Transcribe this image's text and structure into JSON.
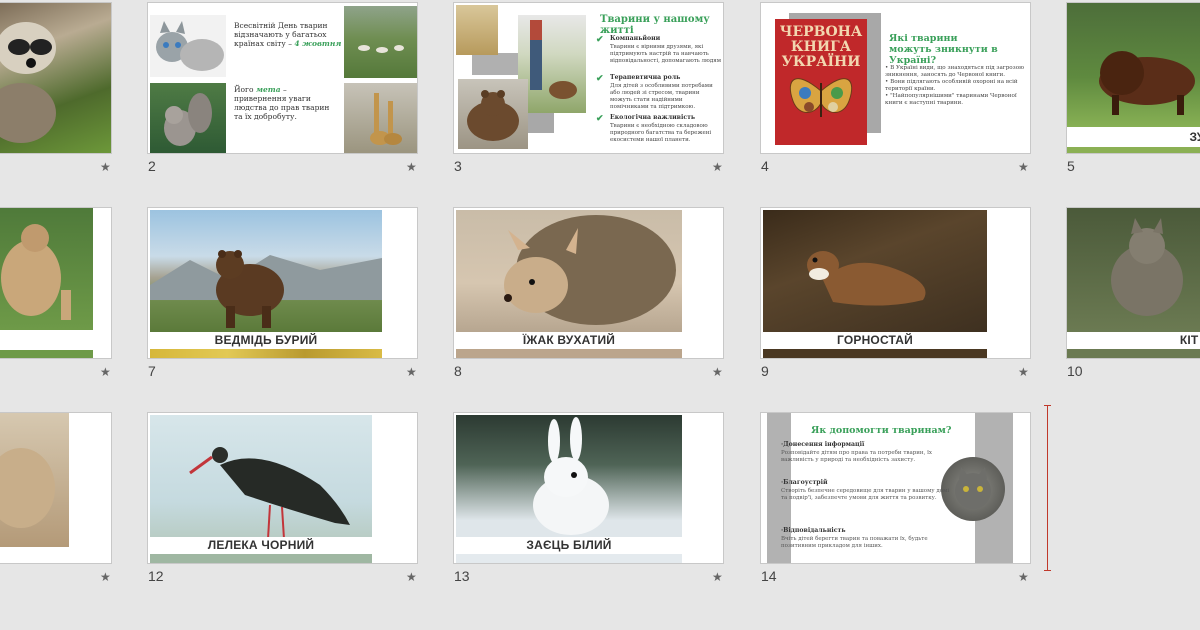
{
  "slides": [
    {
      "number": "",
      "caption": ""
    },
    {
      "number": "2",
      "text1": "Всесвітній День тварин відзначають у багатьох країнах світу –",
      "date": "4 жовтня",
      "text2_a": "Його",
      "text2_em": "мета",
      "text2_b": " – привернення уваги людства до прав тварин та їх добробуту."
    },
    {
      "number": "3",
      "title": "Тварини у нашому житті",
      "items": [
        {
          "head": "Компаньйони",
          "text": "Тварини є вірними друзями, які підтримують настрій та навчають відповідальності, допомагають людям"
        },
        {
          "head": "Терапевтична роль",
          "text": "Для дітей з особливими потребами або людей зі стресом, тварини можуть стати надійними помічниками та підтримкою."
        },
        {
          "head": "Екологічна важливість",
          "text": "Тварини є необхідною складовою природного багатства та бережені екосистеми нашої планети."
        }
      ]
    },
    {
      "number": "4",
      "book_line1": "ЧЕРВОНА",
      "book_line2": "КНИГА",
      "book_line3": "УКРАЇНИ",
      "title": "Які тварини можуть зникнути в Україні?",
      "bullets": [
        "В Україні види, що знаходяться під загрозою зникнення, заносять до Червоної книги.",
        "Вони підлягають особливій охороні на всій території країни.",
        "\"Найпопулярнішими\" тваринами Червоної книги є наступні тварини."
      ]
    },
    {
      "number": "5",
      "caption": "ЗУ"
    },
    {
      "number": "",
      "caption": ""
    },
    {
      "number": "7",
      "caption": "ВЕДМІДЬ БУРИЙ"
    },
    {
      "number": "8",
      "caption": "ЇЖАК ВУХАТИЙ"
    },
    {
      "number": "9",
      "caption": "ГОРНОСТАЙ"
    },
    {
      "number": "10",
      "caption": "КІТ ЛІ"
    },
    {
      "number": "",
      "caption": ""
    },
    {
      "number": "12",
      "caption": "ЛЕЛЕКА ЧОРНИЙ"
    },
    {
      "number": "13",
      "caption": "ЗАЄЦЬ БІЛИЙ"
    },
    {
      "number": "14",
      "title": "Як допомогти тваринам?",
      "sections": [
        {
          "head": "Донесення інформації",
          "text": "Розповідайте дітям про права та потреби тварин, їх важливість у природі та необхідність захисту."
        },
        {
          "head": "Благоустрій",
          "text": "Створіть безпечне середовище для тварин у вашому домі та подвір'ї, забезпечте умови для життя та розвитку."
        },
        {
          "head": "Відповідальність",
          "text": "Вчіть дітей берегти тварин та поважати їх, будьте позитивним прикладом для інших."
        }
      ]
    }
  ],
  "star_icon": "★"
}
